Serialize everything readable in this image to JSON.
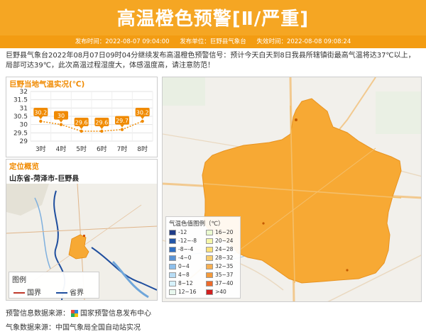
{
  "header": {
    "title": "高温橙色预警[Ⅱ/严重]",
    "published_label": "发布时间：2022-08-07 09:04:00",
    "issuer_label": "发布单位：巨野县气象台",
    "expiry_label": "失效时间：2022-08-08 09:08:24"
  },
  "notice": "巨野县气象台2022年08月07日09时04分继续发布高温橙色预警信号：预计今天白天到8日我县所辖镇街最高气温将达37℃以上，局部可达39℃，此次高温过程湿度大，体感温度高，请注意防范！",
  "temp_panel": {
    "title": "巨野当地气温实况(℃)"
  },
  "chart_data": {
    "type": "line",
    "title": "巨野当地气温实况(℃)",
    "categories": [
      "3时",
      "4时",
      "5时",
      "6时",
      "7时",
      "8时"
    ],
    "values": [
      30.2,
      30,
      29.6,
      29.6,
      29.7,
      30.2
    ],
    "data_labels": [
      "30.2",
      "30",
      "29.6",
      "29.6",
      "29.7",
      "30.2"
    ],
    "yticks": [
      "32",
      "31.5",
      "31",
      "30.5",
      "30",
      "29.5",
      "29"
    ],
    "ylim": [
      29,
      32
    ],
    "grid": true,
    "colors": {
      "line": "#f08a00",
      "label_bg": "#f08a00"
    }
  },
  "location": {
    "title": "定位概览",
    "subtitle": "山东省-菏泽市-巨野县",
    "legend_title": "图例",
    "legend_items": [
      {
        "label": "国界",
        "color": "#c0392b"
      },
      {
        "label": "省界",
        "color": "#1f4e9e"
      }
    ]
  },
  "map_legend": {
    "title": "气温色值图例（℃）",
    "items": [
      {
        "label": "-12",
        "color": "#1f3c88"
      },
      {
        "label": "-12~-8",
        "color": "#2356a8"
      },
      {
        "label": "-8~-4",
        "color": "#2f6fc4"
      },
      {
        "label": "-4~0",
        "color": "#5a94d6"
      },
      {
        "label": "0~4",
        "color": "#8ec0ec"
      },
      {
        "label": "4~8",
        "color": "#b7dcf5"
      },
      {
        "label": "8~12",
        "color": "#d6f1fb"
      },
      {
        "label": "12~16",
        "color": "#e8f7ee"
      },
      {
        "label": "16~20",
        "color": "#eafbd0"
      },
      {
        "label": "20~24",
        "color": "#f6f7a9"
      },
      {
        "label": "24~28",
        "color": "#fbe27b"
      },
      {
        "label": "28~32",
        "color": "#f8cd6e"
      },
      {
        "label": "32~35",
        "color": "#f7b052"
      },
      {
        "label": "35~37",
        "color": "#f49a3a"
      },
      {
        "label": "37~40",
        "color": "#ee6a2a"
      },
      {
        "label": ">40",
        "color": "#d21f1f"
      }
    ]
  },
  "footer": {
    "warning_source": "预警信息数据来源：",
    "warning_source_name": "国家预警信息发布中心",
    "weather_source": "气象数据来源：中国气象局全国自动站实况"
  },
  "colors": {
    "accent": "#f5a623",
    "accent_dark": "#f39c12",
    "warning_area": "#f7a934"
  }
}
